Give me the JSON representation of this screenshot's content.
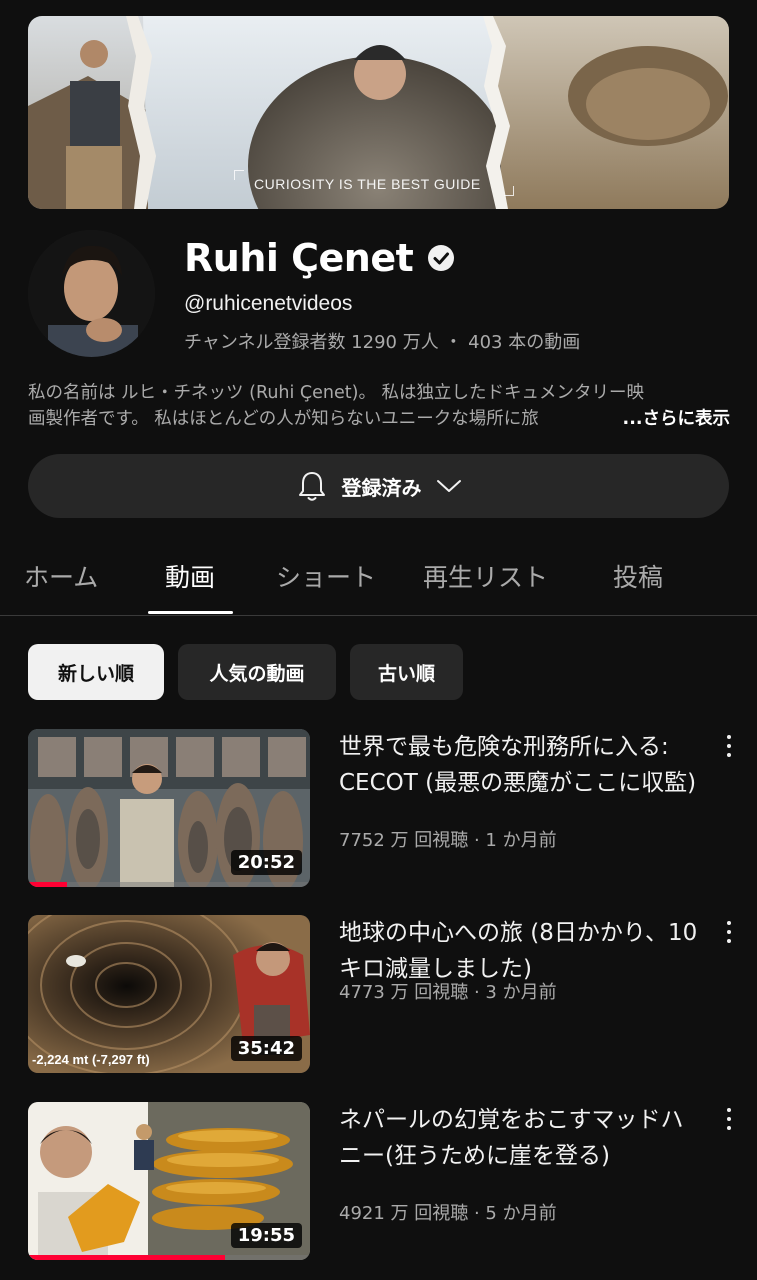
{
  "banner": {
    "tagline": "CURIOSITY IS THE BEST GUIDE"
  },
  "channel": {
    "name": "Ruhi Çenet",
    "handle": "@ruhicenetvideos",
    "stats": "チャンネル登録者数 1290 万人 ・ 403 本の動画",
    "description_line1": "私の名前は ルヒ・チネッツ (Ruhi Çenet)。 私は独立したドキュメンタリー映",
    "description_line2": "画製作者です。 私はほとんどの人が知らないユニークな場所に旅",
    "more_label": "...さらに表示"
  },
  "subscribe": {
    "label": "登録済み",
    "icon": "bell-icon"
  },
  "tabs": [
    "ホーム",
    "動画",
    "ショート",
    "再生リスト",
    "投稿"
  ],
  "active_tab": "動画",
  "chips": [
    "新しい順",
    "人気の動画",
    "古い順"
  ],
  "active_chip": "新しい順",
  "videos": [
    {
      "title": "世界で最も危険な刑務所に入る: CECOT (最悪の悪魔がここに収監)",
      "meta": "7752 万 回視聴 · 1 か月前",
      "duration": "20:52",
      "watched_fraction": 0.14
    },
    {
      "title": "地球の中心への旅 (8日かかり、10 キロ減量しました)",
      "meta": "4773 万 回視聴 · 3 か月前",
      "duration": "35:42",
      "thumb_label": "-2,224 mt  (-7,297 ft)",
      "watched_fraction": 0
    },
    {
      "title": "ネパールの幻覚をおこすマッドハニー(狂うために崖を登る)",
      "meta": "4921 万 回視聴 · 5 か月前",
      "duration": "19:55",
      "watched_fraction": 0.7
    }
  ]
}
